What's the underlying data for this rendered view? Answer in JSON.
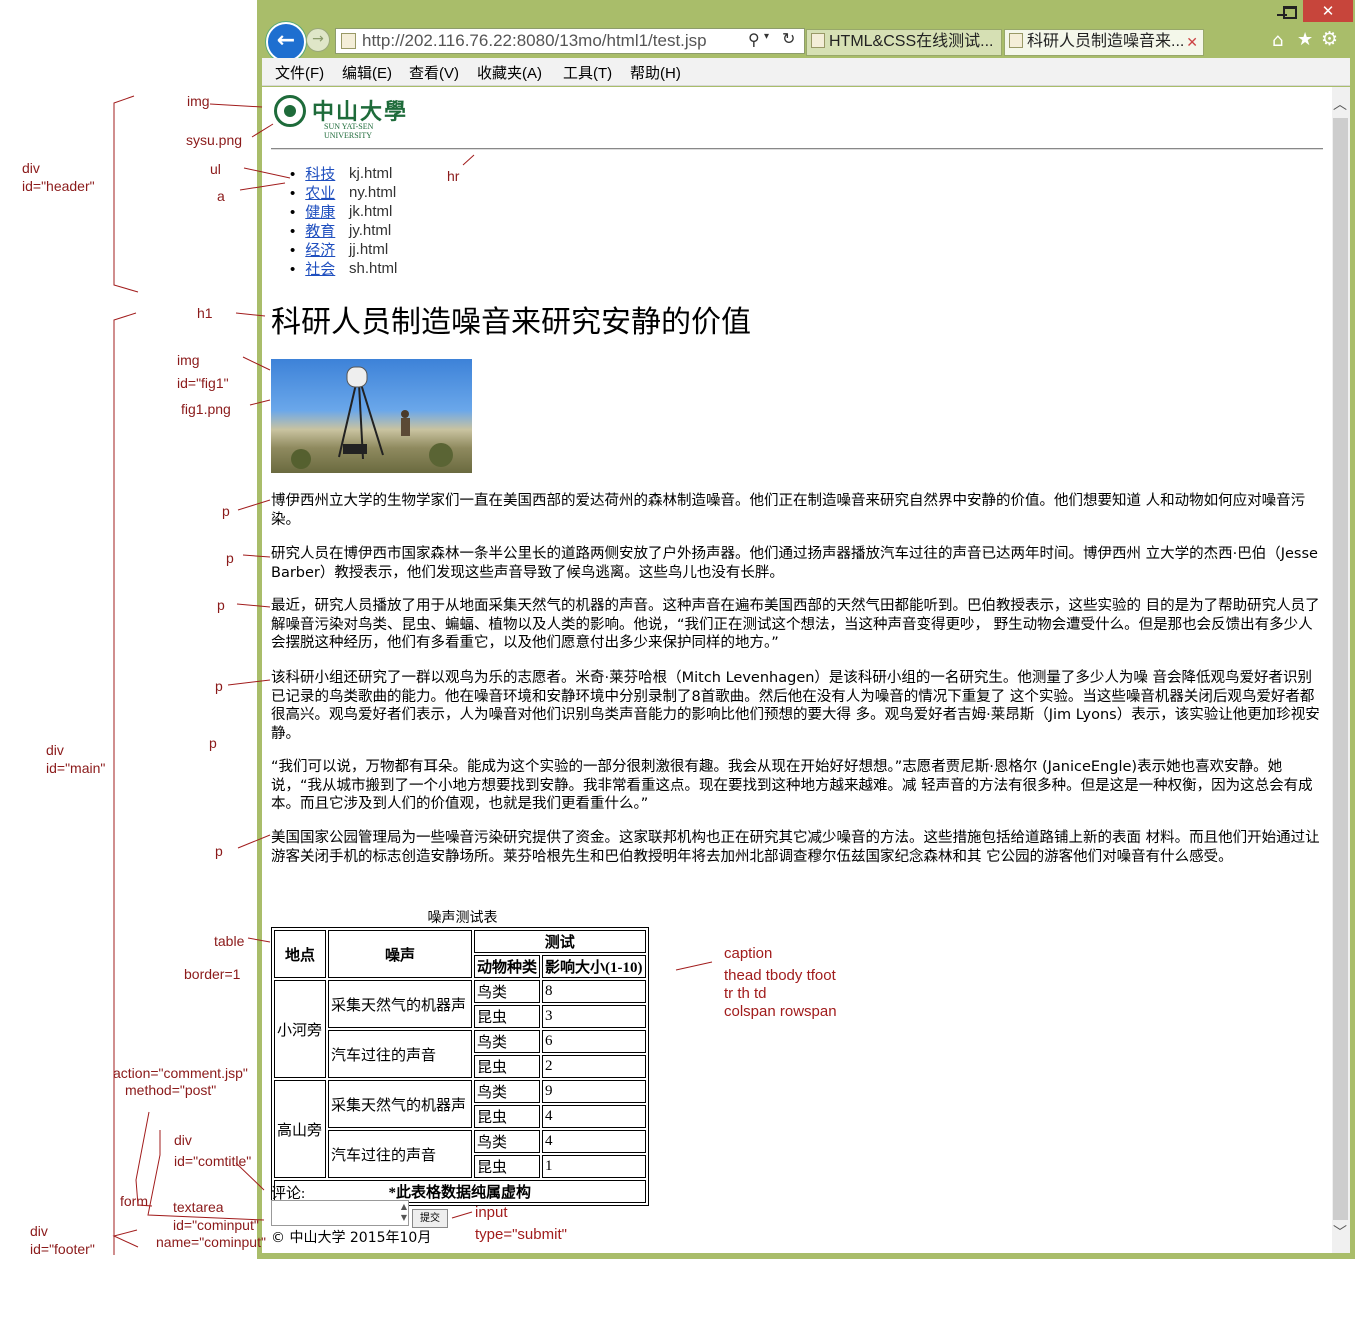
{
  "browser": {
    "url": "http://202.116.76.22:8080/13mo/html1/test.jsp",
    "tabs": [
      {
        "label": "HTML&CSS在线测试..."
      },
      {
        "label": "科研人员制造噪音来..."
      }
    ],
    "menu": [
      "文件(F)",
      "编辑(E)",
      "查看(V)",
      "收藏夹(A)",
      "工具(T)",
      "帮助(H)"
    ]
  },
  "page": {
    "logo": {
      "cn": "中山大學",
      "en": "SUN YAT-SEN UNIVERSITY"
    },
    "nav": [
      {
        "label": "科技",
        "file": "kj.html"
      },
      {
        "label": "农业",
        "file": "ny.html"
      },
      {
        "label": "健康",
        "file": "jk.html"
      },
      {
        "label": "教育",
        "file": "jy.html"
      },
      {
        "label": "经济",
        "file": "jj.html"
      },
      {
        "label": "社会",
        "file": "sh.html"
      }
    ],
    "title": "科研人员制造噪音来研究安静的价值",
    "paragraphs": [
      "博伊西州立大学的生物学家们一直在美国西部的爱达荷州的森林制造噪音。他们正在制造噪音来研究自然界中安静的价值。他们想要知道 人和动物如何应对噪音污染。",
      "研究人员在博伊西市国家森林一条半公里长的道路两侧安放了户外扬声器。他们通过扬声器播放汽车过往的声音已达两年时间。博伊西州 立大学的杰西·巴伯（Jesse Barber）教授表示，他们发现这些声音导致了候鸟逃离。这些鸟儿也没有长胖。",
      "最近，研究人员播放了用于从地面采集天然气的机器的声音。这种声音在遍布美国西部的天然气田都能听到。巴伯教授表示，这些实验的 目的是为了帮助研究人员了解噪音污染对鸟类、昆虫、蝙蝠、植物以及人类的影响。他说，“我们正在测试这个想法，当这种声音变得更吵， 野生动物会遭受什么。但是那也会反馈出有多少人会摆脱这种经历，他们有多看重它，以及他们愿意付出多少来保护同样的地方。”",
      "该科研小组还研究了一群以观鸟为乐的志愿者。米奇·莱芬哈根（Mitch Levenhagen）是该科研小组的一名研究生。他测量了多少人为噪 音会降低观鸟爱好者识别已记录的鸟类歌曲的能力。他在噪音环境和安静环境中分别录制了8首歌曲。然后他在没有人为噪音的情况下重复了 这个实验。当这些噪音机器关闭后观鸟爱好者都很高兴。观鸟爱好者们表示，人为噪音对他们识别鸟类声音能力的影响比他们预想的要大得 多。观鸟爱好者吉姆·莱昂斯（Jim Lyons）表示，该实验让他更加珍视安静。",
      "“我们可以说，万物都有耳朵。能成为这个实验的一部分很刺激很有趣。我会从现在开始好好想想。”志愿者贾尼斯·恩格尔 (JaniceEngle)表示她也喜欢安静。她说，“我从城市搬到了一个小地方想要找到安静。我非常看重这点。现在要找到这种地方越来越难。减 轻声音的方法有很多种。但是这是一种权衡，因为这总会有成本。而且它涉及到人们的价值观，也就是我们更看重什么。”",
      "美国国家公园管理局为一些噪音污染研究提供了资金。这家联邦机构也正在研究其它减少噪音的方法。这些措施包括给道路铺上新的表面 材料。而且他们开始通过让游客关闭手机的标志创造安静场所。莱芬哈根先生和巴伯教授明年将去加州北部调查穆尔伍兹国家纪念森林和其 它公园的游客他们对噪音有什么感受。"
    ],
    "table": {
      "caption": "噪声测试表",
      "h_place": "地点",
      "h_noise": "噪声",
      "h_test": "测试",
      "h_species": "动物种类",
      "h_impact": "影响大小(1-10)",
      "rows": [
        {
          "place": "小河旁",
          "noise": "采集天然气的机器声",
          "species": "鸟类",
          "impact": "8"
        },
        {
          "species": "昆虫",
          "impact": "3"
        },
        {
          "noise": "汽车过往的声音",
          "species": "鸟类",
          "impact": "6"
        },
        {
          "species": "昆虫",
          "impact": "2"
        },
        {
          "place": "高山旁",
          "noise": "采集天然气的机器声",
          "species": "鸟类",
          "impact": "9"
        },
        {
          "species": "昆虫",
          "impact": "4"
        },
        {
          "noise": "汽车过往的声音",
          "species": "鸟类",
          "impact": "4"
        },
        {
          "species": "昆虫",
          "impact": "1"
        }
      ],
      "foot": "*此表格数据纯属虚构"
    },
    "comment_label": "评论:",
    "submit_label": "提交",
    "footer": "© 中山大学 2015年10月"
  },
  "annotations": {
    "img1": "img",
    "sysu": "sysu.png",
    "ul": "ul",
    "a": "a",
    "hr": "hr",
    "header_div": "div",
    "header_id": "id=\"header\"",
    "h1": "h1",
    "img2": "img",
    "fig1_id": "id=\"fig1\"",
    "fig1_png": "fig1.png",
    "p": "p",
    "main_div": "div",
    "main_id": "id=\"main\"",
    "table": "table",
    "border": "border=1",
    "caption": "caption",
    "thead": "thead  tbody tfoot",
    "trthtd": "tr th td",
    "colspan": "colspan rowspan",
    "action": "action=\"comment.jsp\"",
    "method": "method=\"post\"",
    "comtitle_div": "div",
    "comtitle_id": "id=\"comtitle\"",
    "form": "form",
    "textarea": "textarea",
    "cominput_id": "id=\"cominput\"",
    "cominput_name": "name=\"cominput\"",
    "input": "input",
    "input_type": "type=\"submit\"",
    "footer_div": "div",
    "footer_id": "id=\"footer\""
  }
}
